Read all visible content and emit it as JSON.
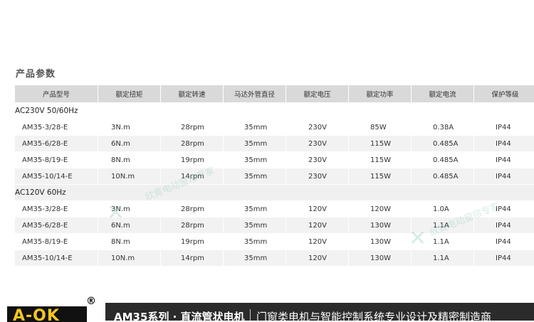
{
  "section": {
    "title": "产品参数"
  },
  "table": {
    "headers": [
      "产品型号",
      "额定扭矩",
      "额定转速",
      "马达外管直径",
      "额定电压",
      "额定功率",
      "额定电流",
      "保护等级"
    ],
    "groups": [
      {
        "label": "AC230V 50/60Hz",
        "rows": [
          [
            "AM35-3/28-E",
            "3N.m",
            "28rpm",
            "35mm",
            "230V",
            "85W",
            "0.38A",
            "IP44"
          ],
          [
            "AM35-6/28-E",
            "6N.m",
            "28rpm",
            "35mm",
            "230V",
            "115W",
            "0.485A",
            "IP44"
          ],
          [
            "AM35-8/19-E",
            "8N.m",
            "19rpm",
            "35mm",
            "230V",
            "115W",
            "0.485A",
            "IP44"
          ],
          [
            "AM35-10/14-E",
            "10N.m",
            "14rpm",
            "35mm",
            "230V",
            "115W",
            "0.485A",
            "IP44"
          ]
        ]
      },
      {
        "label": "AC120V  60Hz",
        "rows": [
          [
            "AM35-3/28-E",
            "3N.m",
            "28rpm",
            "35mm",
            "120V",
            "120W",
            "1.0A",
            "IP44"
          ],
          [
            "AM35-6/28-E",
            "6N.m",
            "28rpm",
            "35mm",
            "120V",
            "130W",
            "1.1A",
            "IP44"
          ],
          [
            "AM35-8/19-E",
            "8N.m",
            "19rpm",
            "35mm",
            "120V",
            "130W",
            "1.1A",
            "IP44"
          ],
          [
            "AM35-10/14-E",
            "10N.m",
            "14rpm",
            "35mm",
            "120V",
            "130W",
            "1.1A",
            "IP44"
          ]
        ]
      }
    ]
  },
  "watermark": {
    "text": "欣青电动窗帘专家"
  },
  "footer": {
    "logo": "A-OK",
    "registered": "®",
    "series": "AM35系列 · 直流管状电机",
    "slogan": "门窗类电机与智能控制系统专业设计及精密制造商"
  },
  "colors": {
    "header_bg": "#d9d9d9",
    "alt_row_bg": "#f2f2f2",
    "footer_bg": "#2b2b2b",
    "logo_yellow": "#f3c623"
  }
}
